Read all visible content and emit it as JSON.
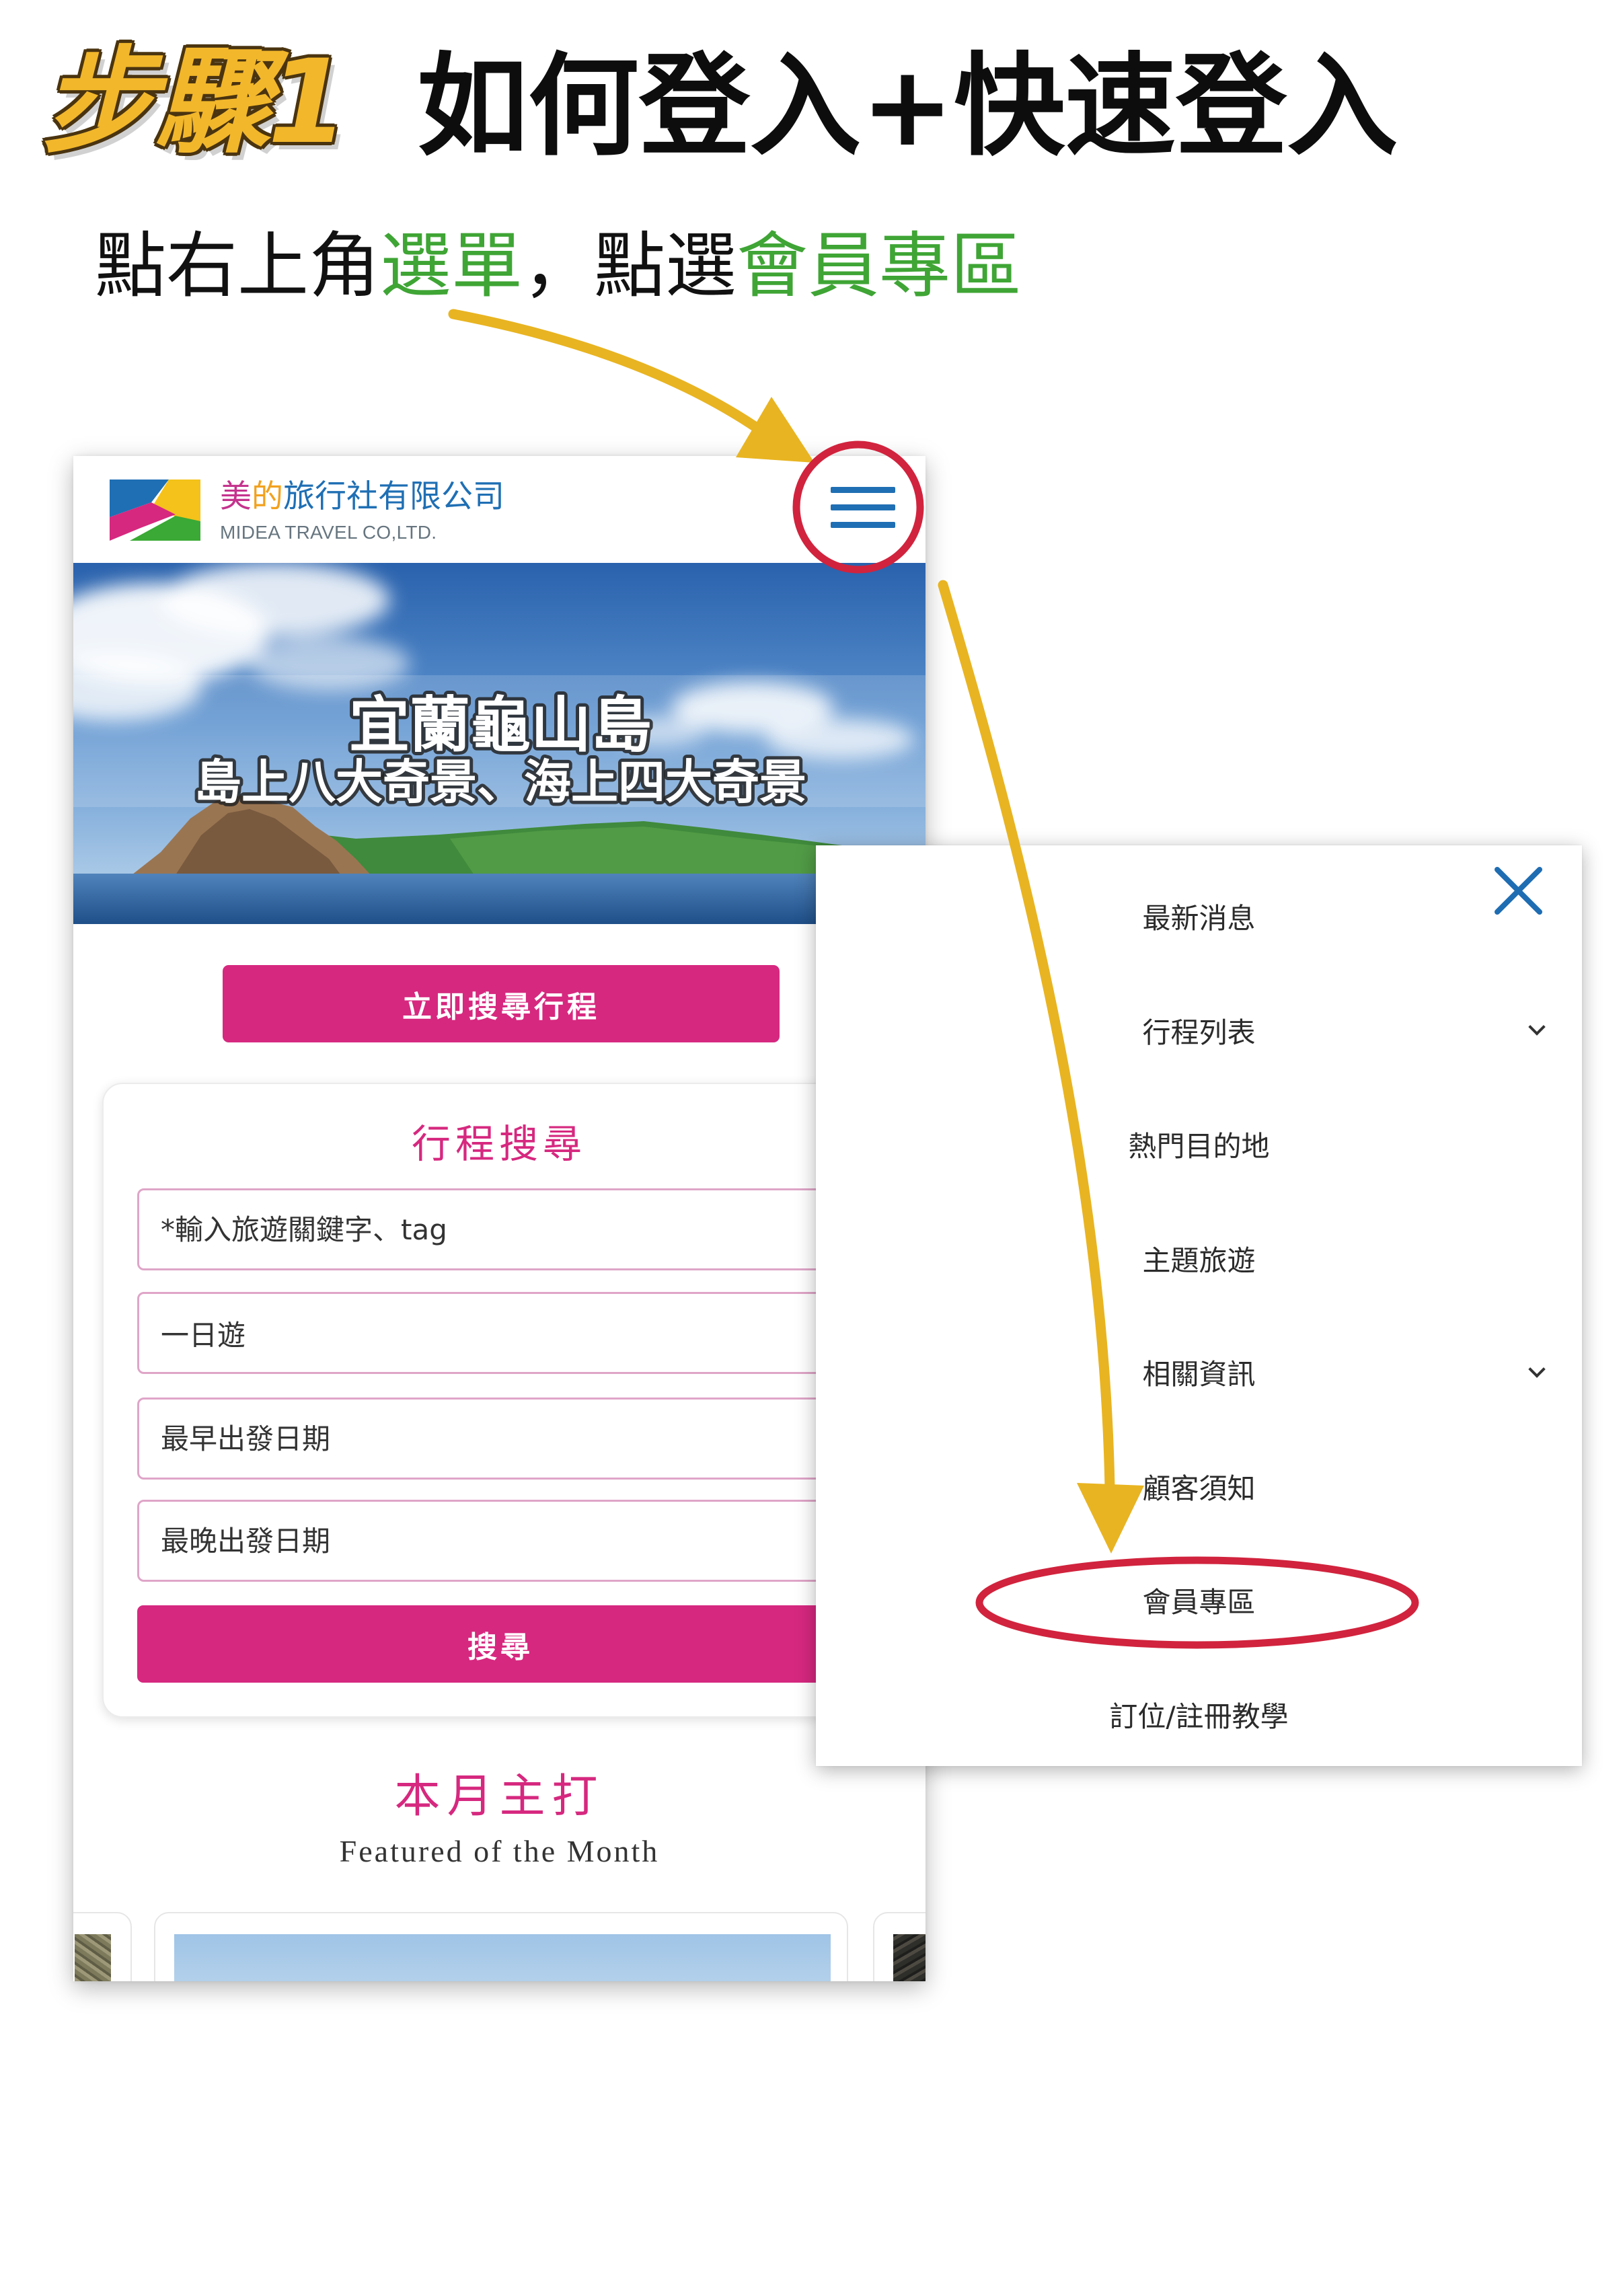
{
  "tutorial": {
    "step_label": "步驟1",
    "heading": "如何登入+快速登入",
    "instruction": {
      "text1": "點右上角",
      "highlight1": "選單",
      "text2": "，點選",
      "highlight2": "會員專區"
    }
  },
  "colors": {
    "accent_pink": "#d6287f",
    "highlight_green": "#3fa535",
    "step_yellow": "#f2b72b",
    "arrow_yellow": "#e8b421",
    "circle_red": "#d1233d",
    "brand_blue": "#1f6fb4"
  },
  "phone": {
    "header": {
      "logo_icon": "midea-logo-icon",
      "company_name": {
        "char1": "美",
        "char2": "的",
        "rest": "旅行社有限公司"
      },
      "company_name_en": "MIDEA TRAVEL CO,LTD.",
      "menu_icon": "hamburger-menu-icon"
    },
    "banner": {
      "title": "宜蘭龜山島",
      "subtitle": "島上八大奇景、海上四大奇景"
    },
    "quick_search_button": "立即搜尋行程",
    "search_form": {
      "title": "行程搜尋",
      "keyword_placeholder": "*輸入旅遊關鍵字、tag",
      "trip_type_value": "一日遊",
      "earliest_date_placeholder": "最早出發日期",
      "latest_date_placeholder": "最晚出發日期",
      "search_button": "搜尋"
    },
    "featured": {
      "title": "本月主打",
      "subtitle": "Featured of the Month"
    }
  },
  "menu": {
    "close_icon": "close-icon",
    "items": [
      {
        "label": "最新消息",
        "has_submenu": false
      },
      {
        "label": "行程列表",
        "has_submenu": true
      },
      {
        "label": "熱門目的地",
        "has_submenu": false
      },
      {
        "label": "主題旅遊",
        "has_submenu": false
      },
      {
        "label": "相關資訊",
        "has_submenu": true
      },
      {
        "label": "顧客須知",
        "has_submenu": false
      },
      {
        "label": "會員專區",
        "has_submenu": false,
        "highlighted": true
      },
      {
        "label": "訂位/註冊教學",
        "has_submenu": false
      }
    ]
  }
}
